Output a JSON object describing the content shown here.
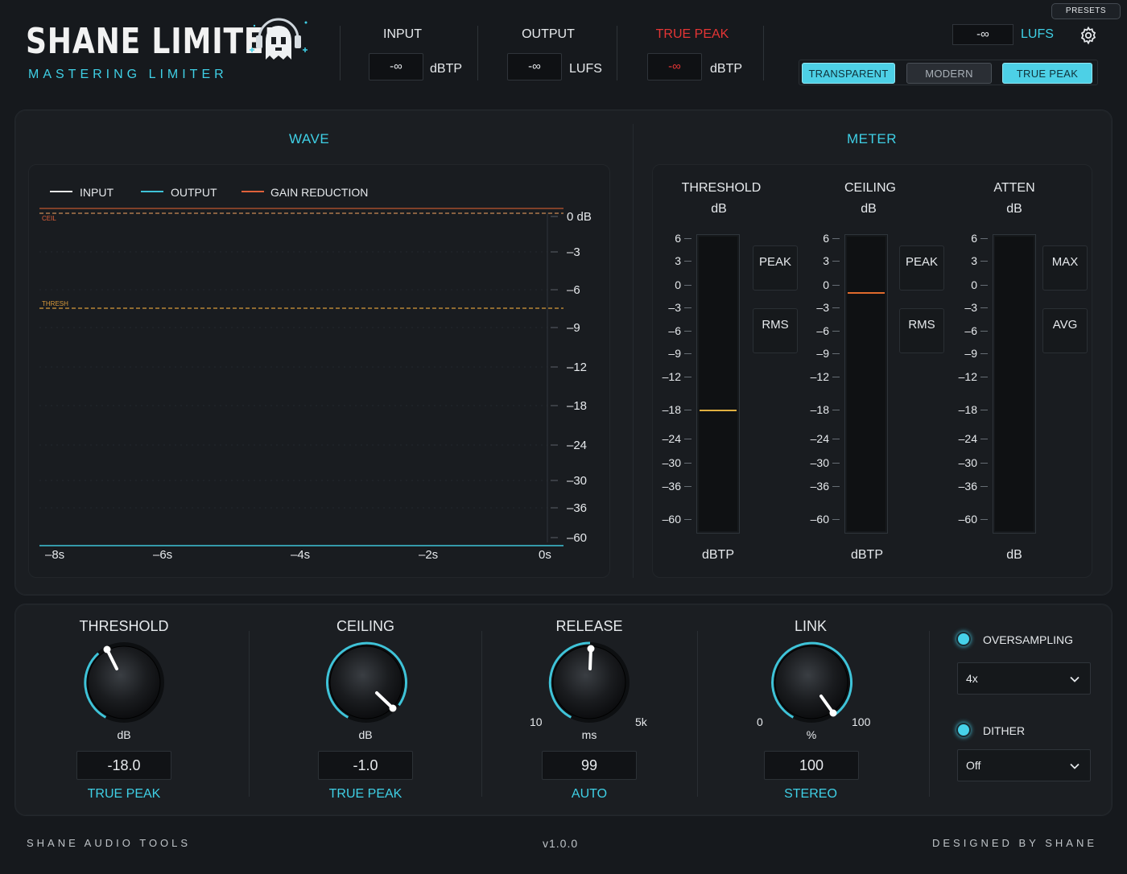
{
  "header": {
    "title": "SHANE LIMITER",
    "subtitle": "MASTERING LIMITER",
    "input_label": "INPUT",
    "input_value": "-∞",
    "input_unit": "dBTP",
    "output_label": "OUTPUT",
    "output_value": "-∞",
    "output_unit": "LUFS",
    "truepeak_label": "TRUE PEAK",
    "truepeak_value": "-∞",
    "truepeak_unit": "dBTP",
    "presets_label": "PRESETS",
    "lufs_value": "-∞",
    "lufs_label": "LUFS",
    "modes": [
      {
        "label": "TRANSPARENT",
        "active": true
      },
      {
        "label": "MODERN",
        "active": false
      },
      {
        "label": "TRUE PEAK",
        "active": true
      }
    ]
  },
  "wave": {
    "title": "WAVE",
    "legend": [
      {
        "label": "INPUT",
        "color": "#e8e8e8"
      },
      {
        "label": "OUTPUT",
        "color": "#3fc3d8"
      },
      {
        "label": "GAIN REDUCTION",
        "color": "#e0613a"
      }
    ],
    "ceil_label": "CEIL",
    "thresh_label": "THRESH",
    "y_labels": [
      "0 dB",
      "–3",
      "–6",
      "–9",
      "–12",
      "–18",
      "–24",
      "–30",
      "–36",
      "–60"
    ],
    "x_labels": [
      "–8s",
      "–6s",
      "–4s",
      "–2s",
      "0s"
    ]
  },
  "meter": {
    "title": "METER",
    "scale": [
      "6",
      "3",
      "0",
      "–3",
      "–6",
      "–9",
      "–12",
      "–18",
      "–24",
      "–30",
      "–36",
      "–60"
    ],
    "groups": [
      {
        "title": "THRESHOLD",
        "sub": "dB",
        "unit": "dBTP",
        "btn1": "PEAK",
        "btn2": "RMS",
        "marker_db": -18.0,
        "marker_color": "#e0b040"
      },
      {
        "title": "CEILING",
        "sub": "dB",
        "unit": "dBTP",
        "btn1": "PEAK",
        "btn2": "RMS",
        "marker_db": -1.0,
        "marker_color": "#e06a2c"
      },
      {
        "title": "ATTEN",
        "sub": "dB",
        "unit": "dB",
        "btn1": "MAX",
        "btn2": "AVG"
      }
    ]
  },
  "controls": {
    "threshold": {
      "title": "THRESHOLD",
      "unit": "dB",
      "value": "-18.0",
      "mode": "TRUE PEAK"
    },
    "ceiling": {
      "title": "CEILING",
      "unit": "dB",
      "value": "-1.0",
      "mode": "TRUE PEAK"
    },
    "release": {
      "title": "RELEASE",
      "unit": "ms",
      "min": "10",
      "max": "5k",
      "value": "99",
      "mode": "AUTO"
    },
    "link": {
      "title": "LINK",
      "unit": "%",
      "min": "0",
      "max": "100",
      "value": "100",
      "mode": "STEREO"
    },
    "oversampling": {
      "label": "OVERSAMPLING",
      "value": "4x"
    },
    "dither": {
      "label": "DITHER",
      "value": "Off"
    }
  },
  "footer": {
    "left": "SHANE AUDIO TOOLS",
    "version": "v1.0.0",
    "right": "DESIGNED BY SHANE"
  },
  "colors": {
    "accent": "#3fd0e6",
    "truepeak": "#e53535",
    "background": "#16191d"
  }
}
